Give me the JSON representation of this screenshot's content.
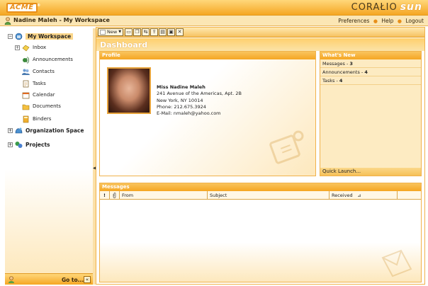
{
  "header": {
    "logo": "ACME",
    "logo_mark": "®",
    "brand": "CORAŁIO",
    "brand_sun": "sun"
  },
  "userbar": {
    "title": "Nadine Maleh - My Workspace",
    "links": [
      "Preferences",
      "Help",
      "Logout"
    ]
  },
  "sidebar": {
    "items": [
      {
        "label": "My Workspace",
        "icon": "workspace-icon"
      },
      {
        "label": "Inbox",
        "icon": "inbox-icon"
      },
      {
        "label": "Announcements",
        "icon": "announcements-icon"
      },
      {
        "label": "Contacts",
        "icon": "contacts-icon"
      },
      {
        "label": "Tasks",
        "icon": "tasks-icon"
      },
      {
        "label": "Calendar",
        "icon": "calendar-icon"
      },
      {
        "label": "Documents",
        "icon": "documents-icon"
      },
      {
        "label": "Binders",
        "icon": "binders-icon"
      },
      {
        "label": "Organization Space",
        "icon": "organization-icon"
      },
      {
        "label": "Projects",
        "icon": "projects-icon"
      }
    ],
    "goto": "Go to...",
    "goto_button": "«"
  },
  "toolbar": {
    "new_label": "New"
  },
  "dashboard": {
    "title": "Dashboard",
    "profile": {
      "header": "Profile",
      "name": "Miss Nadine Maleh",
      "address1": "241 Avenue of the Americas, Apt. 2B",
      "address2": "New York, NY  10014",
      "phone": "Phone: 212.675.3924",
      "email": "E-Mail: nmaleh@yahoo.com"
    },
    "whats_new": {
      "header": "What's New",
      "items": [
        {
          "label": "Messages - ",
          "count": "3"
        },
        {
          "label": "Announcements - ",
          "count": "4"
        },
        {
          "label": "Tasks - ",
          "count": "4"
        }
      ],
      "quick_launch": "Quick Launch..."
    },
    "messages": {
      "header": "Messages",
      "columns": [
        "!",
        "📎",
        "From",
        "Subject",
        "Received"
      ]
    }
  },
  "colors": {
    "accent": "#f5a623",
    "panel_bg": "#fdebc2"
  }
}
